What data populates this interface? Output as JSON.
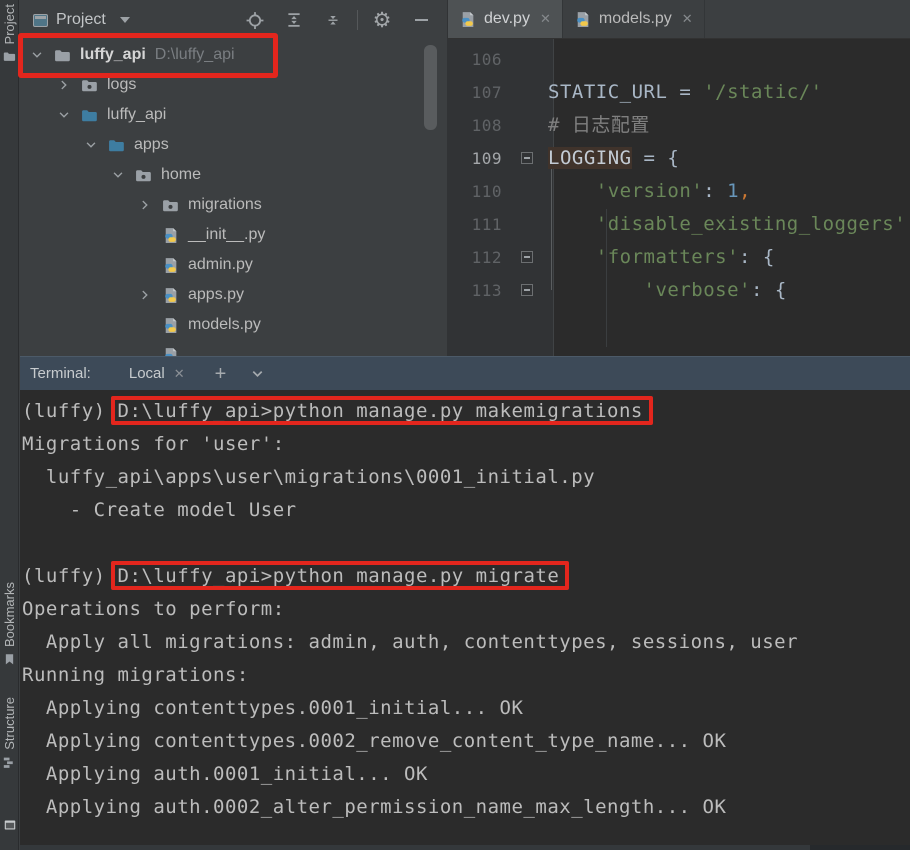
{
  "colors": {
    "annotation_red": "#e3261d",
    "folder_blue": "#3e7da1",
    "terminal_header": "#3d4a58"
  },
  "stripe": {
    "top": [
      {
        "label": "Project",
        "icon": "folder-icon"
      }
    ],
    "bottom": [
      {
        "label": "Bookmarks",
        "icon": "bookmark-icon"
      },
      {
        "label": "Structure",
        "icon": "structure-icon"
      }
    ]
  },
  "project": {
    "title": "Project",
    "toolbar_icons": [
      "locate",
      "expand-all",
      "collapse-all",
      "separator",
      "settings-gear",
      "hide"
    ],
    "tree": [
      {
        "label": "luffy_api",
        "path": "D:\\luffy_api",
        "level": 0,
        "icon": "folder-root",
        "chevron": "expanded",
        "bold": true
      },
      {
        "label": "logs",
        "level": 1,
        "icon": "folder-dot",
        "chevron": "collapsed"
      },
      {
        "label": "luffy_api",
        "level": 1,
        "icon": "folder-blue",
        "chevron": "expanded"
      },
      {
        "label": "apps",
        "level": 2,
        "icon": "folder-blue",
        "chevron": "expanded"
      },
      {
        "label": "home",
        "level": 3,
        "icon": "folder-dot",
        "chevron": "expanded"
      },
      {
        "label": "migrations",
        "level": 4,
        "icon": "folder-dot",
        "chevron": "collapsed"
      },
      {
        "label": "__init__.py",
        "level": 4,
        "icon": "python-file",
        "chevron": "none"
      },
      {
        "label": "admin.py",
        "level": 4,
        "icon": "python-file",
        "chevron": "none"
      },
      {
        "label": "apps.py",
        "level": 4,
        "icon": "python-file",
        "chevron": "collapsed"
      },
      {
        "label": "models.py",
        "level": 4,
        "icon": "python-file",
        "chevron": "none"
      },
      {
        "label": "",
        "level": 4,
        "icon": "python-file",
        "chevron": "none"
      }
    ]
  },
  "editor": {
    "tabs": [
      {
        "label": "dev.py",
        "active": true
      },
      {
        "label": "models.py",
        "active": false
      }
    ],
    "lines": [
      {
        "num": "106",
        "tokens": []
      },
      {
        "num": "107",
        "tokens": [
          [
            "plain",
            "STATIC_URL = "
          ],
          [
            "string",
            "'/static/'"
          ]
        ]
      },
      {
        "num": "108",
        "tokens": [
          [
            "comment",
            "# 日志配置"
          ]
        ]
      },
      {
        "num": "109",
        "fold": true,
        "current": true,
        "tokens": [
          [
            "hl",
            "LOGGING"
          ],
          [
            "plain",
            " = {"
          ]
        ]
      },
      {
        "num": "110",
        "tokens": [
          [
            "plain",
            "    "
          ],
          [
            "string",
            "'version'"
          ],
          [
            "plain",
            ": "
          ],
          [
            "number",
            "1"
          ],
          [
            "comma",
            ","
          ]
        ]
      },
      {
        "num": "111",
        "tokens": [
          [
            "plain",
            "    "
          ],
          [
            "string",
            "'disable_existing_loggers'"
          ]
        ]
      },
      {
        "num": "112",
        "fold": true,
        "tokens": [
          [
            "plain",
            "    "
          ],
          [
            "string",
            "'formatters'"
          ],
          [
            "plain",
            ": {"
          ]
        ]
      },
      {
        "num": "113",
        "fold": true,
        "tokens": [
          [
            "plain",
            "        "
          ],
          [
            "string",
            "'verbose'"
          ],
          [
            "plain",
            ": {"
          ]
        ]
      }
    ]
  },
  "terminal": {
    "label": "Terminal:",
    "tab": "Local",
    "header_icons": [
      "close",
      "add",
      "chevron-down"
    ],
    "lines": [
      {
        "prefix": "(luffy) ",
        "boxed": "D:\\luffy_api>python manage.py makemigrations"
      },
      {
        "text": "Migrations for 'user':"
      },
      {
        "text": "  luffy_api\\apps\\user\\migrations\\0001_initial.py"
      },
      {
        "text": "    - Create model User"
      },
      {
        "text": ""
      },
      {
        "prefix": "(luffy) ",
        "boxed": "D:\\luffy_api>python manage.py migrate"
      },
      {
        "text": "Operations to perform:"
      },
      {
        "text": "  Apply all migrations: admin, auth, contenttypes, sessions, user"
      },
      {
        "text": "Running migrations:"
      },
      {
        "text": "  Applying contenttypes.0001_initial... OK"
      },
      {
        "text": "  Applying contenttypes.0002_remove_content_type_name... OK"
      },
      {
        "text": "  Applying auth.0001_initial... OK"
      },
      {
        "text": "  Applying auth.0002_alter_permission_name_max_length... OK"
      }
    ]
  }
}
